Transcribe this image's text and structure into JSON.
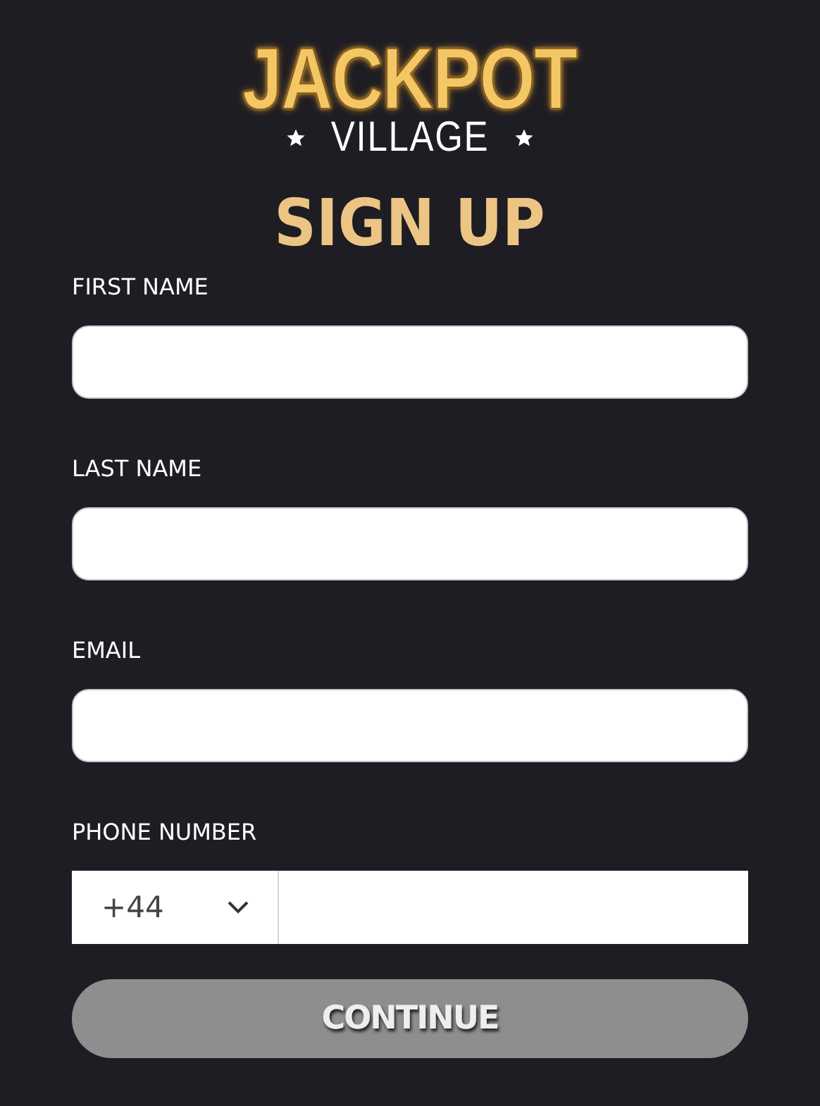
{
  "logo": {
    "line_1": "JACKPOT",
    "line_2": "VILLAGE"
  },
  "title": "SIGN UP",
  "fields": [
    {
      "kind": "text",
      "label": "FIRST NAME"
    },
    {
      "kind": "text",
      "label": "LAST NAME"
    },
    {
      "kind": "text",
      "label": "EMAIL"
    },
    {
      "kind": "phone",
      "label": "PHONE NUMBER",
      "country_code": "+44"
    }
  ],
  "submit": {
    "label": "CONTINUE",
    "disabled": true
  }
}
